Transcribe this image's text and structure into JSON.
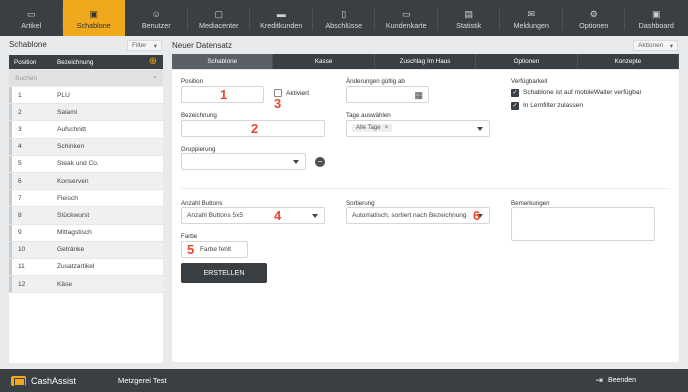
{
  "nav": {
    "items": [
      {
        "label": "Artikel",
        "icon": "register-icon"
      },
      {
        "label": "Schablone",
        "icon": "template-icon",
        "active": true
      },
      {
        "label": "Benutzer",
        "icon": "users-icon"
      },
      {
        "label": "Mediacenter",
        "icon": "media-icon"
      },
      {
        "label": "Kreditkunden",
        "icon": "credit-card-icon"
      },
      {
        "label": "Abschlüsse",
        "icon": "document-icon"
      },
      {
        "label": "Kundenkarte",
        "icon": "customer-card-icon"
      },
      {
        "label": "Statistik",
        "icon": "statistics-icon"
      },
      {
        "label": "Meldungen",
        "icon": "mail-icon"
      },
      {
        "label": "Optionen",
        "icon": "gear-icon"
      },
      {
        "label": "Dashboard",
        "icon": "dashboard-icon"
      }
    ]
  },
  "left": {
    "title": "Schablone",
    "filter_label": "Filter",
    "col_position": "Position",
    "col_name": "Bezeichnung",
    "search_placeholder": "Suchen",
    "rows": [
      {
        "pos": "1",
        "name": "PLU"
      },
      {
        "pos": "2",
        "name": "Salami"
      },
      {
        "pos": "3",
        "name": "Aufschnitt"
      },
      {
        "pos": "4",
        "name": "Schinken"
      },
      {
        "pos": "5",
        "name": "Steak und Co."
      },
      {
        "pos": "6",
        "name": "Konserven"
      },
      {
        "pos": "7",
        "name": "Fleisch"
      },
      {
        "pos": "8",
        "name": "Stückwurst"
      },
      {
        "pos": "9",
        "name": "Mittagstisch"
      },
      {
        "pos": "10",
        "name": "Getränke"
      },
      {
        "pos": "11",
        "name": "Zusatzartikel"
      },
      {
        "pos": "12",
        "name": "Käse"
      }
    ]
  },
  "right": {
    "title": "Neuer Datensatz",
    "actions_label": "Aktionen",
    "tabs": [
      "Schablone",
      "Kasse",
      "Zuschlag Im Haus",
      "Optionen",
      "Konzepte"
    ]
  },
  "form": {
    "position_label": "Position",
    "position_value": "",
    "aktiviert_label": "Aktiviert",
    "aenderungen_label": "Änderungen gültig ab",
    "verfuegbarkeit_label": "Verfügbarkeit",
    "mobile_label": "Schablone ist auf mobileWaiter verfügbar",
    "lernfilter_label": "In Lernfilter zulassen",
    "bezeichnung_label": "Bezeichnung",
    "tage_label": "Tage auswählen",
    "tage_value": "Alle Tage",
    "gruppierung_label": "Gruppierung",
    "anzahl_label": "Anzahl Buttons",
    "anzahl_value": "Anzahl Buttons 5x5",
    "sortierung_label": "Sortierung",
    "sortierung_value": "Automatisch, sortiert nach Bezeichnung",
    "bemerkungen_label": "Bemerkungen",
    "farbe_label": "Farbe",
    "farbe_value": "Farbe fehlt",
    "create_label": "ERSTELLEN"
  },
  "markers": [
    "1",
    "2",
    "3",
    "4",
    "5",
    "6"
  ],
  "footer": {
    "brand": "CashAssist",
    "store": "Metzgerei Test",
    "logout_label": "Beenden"
  },
  "colors": {
    "accent": "#f0a81c",
    "dark": "#3a3f44",
    "marker": "#e8472b"
  }
}
